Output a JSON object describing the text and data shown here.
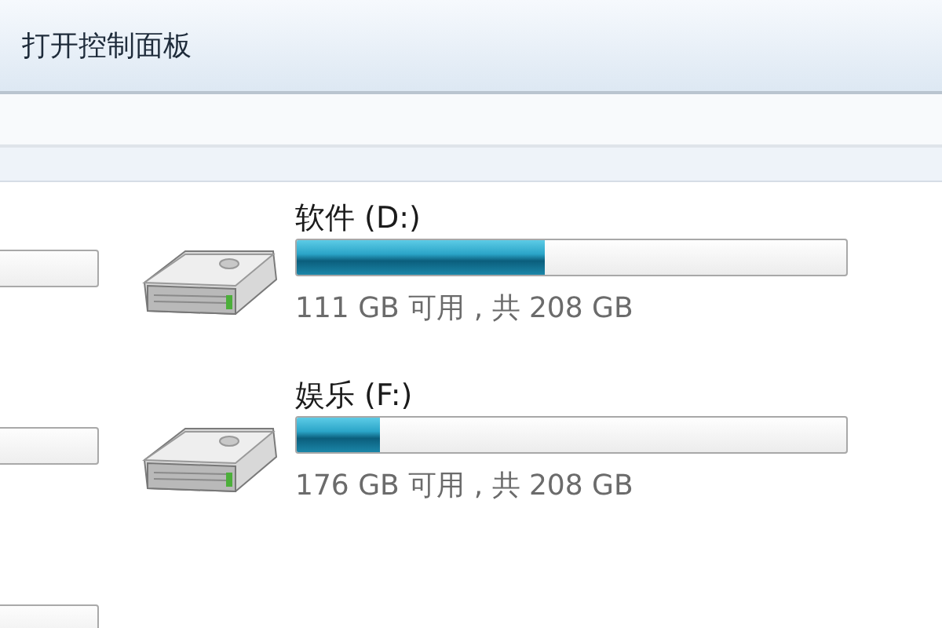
{
  "toolbar": {
    "command": "打开控制面板"
  },
  "drives": [
    {
      "name": "软件 (D:)",
      "level": 0.45,
      "space": "111 GB 可用 , 共 208 GB"
    },
    {
      "name": "娱乐 (F:)",
      "level": 0.15,
      "space": "176 GB 可用 , 共 208 GB"
    }
  ]
}
